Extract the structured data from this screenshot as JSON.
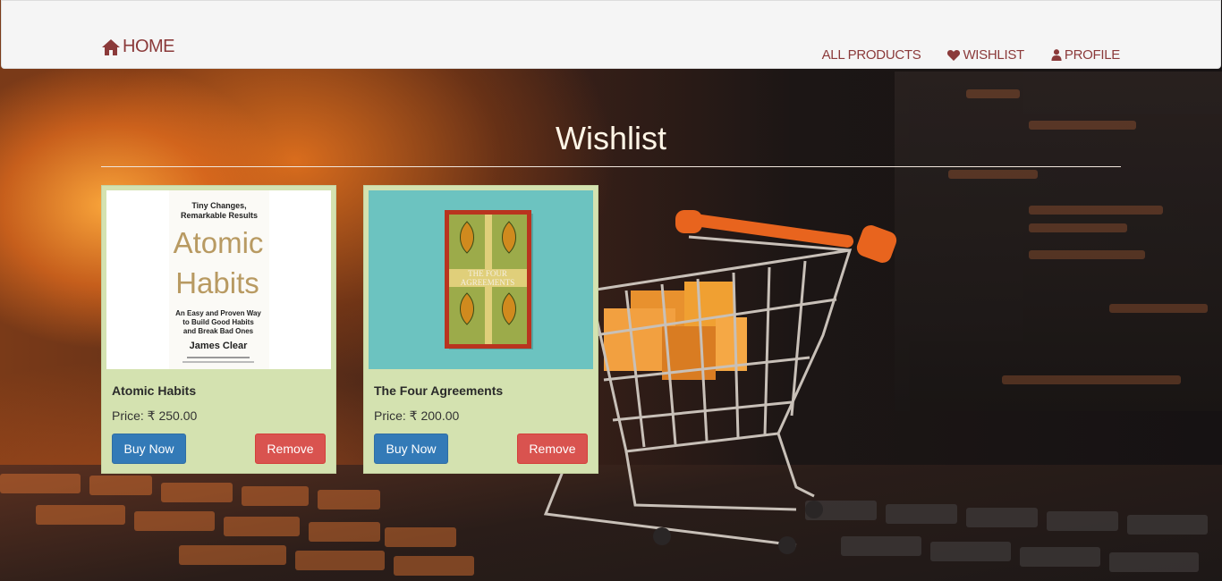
{
  "navbar": {
    "brand_label": "HOME",
    "links": [
      {
        "label": "ALL PRODUCTS"
      },
      {
        "label": "WISHLIST"
      },
      {
        "label": "PROFILE"
      }
    ]
  },
  "page": {
    "title": "Wishlist"
  },
  "cards": [
    {
      "title": "Atomic Habits",
      "price": "Price: ₹ 250.00",
      "buy_label": "Buy Now",
      "remove_label": "Remove",
      "cover": {
        "tagline_line1": "Tiny Changes,",
        "tagline_line2": "Remarkable Results",
        "title_line1": "Atomic",
        "title_line2": "Habits",
        "subtitle_line1": "An Easy and Proven Way",
        "subtitle_line2": "to Build Good Habits",
        "subtitle_line3": "and Break Bad Ones",
        "author": "James Clear"
      }
    },
    {
      "title": "The Four Agreements",
      "price": "Price: ₹ 200.00",
      "buy_label": "Buy Now",
      "remove_label": "Remove",
      "cover": {
        "title_line1": "THE FOUR",
        "title_line2": "AGREEMENTS"
      }
    }
  ],
  "colors": {
    "nav_text": "#8b3a3a",
    "card_bg": "#d4e2b0",
    "buy_button": "#337ab7",
    "remove_button": "#d9534f"
  },
  "icons": {
    "brand": "home-icon",
    "wishlist": "heart-icon",
    "profile": "user-icon"
  }
}
